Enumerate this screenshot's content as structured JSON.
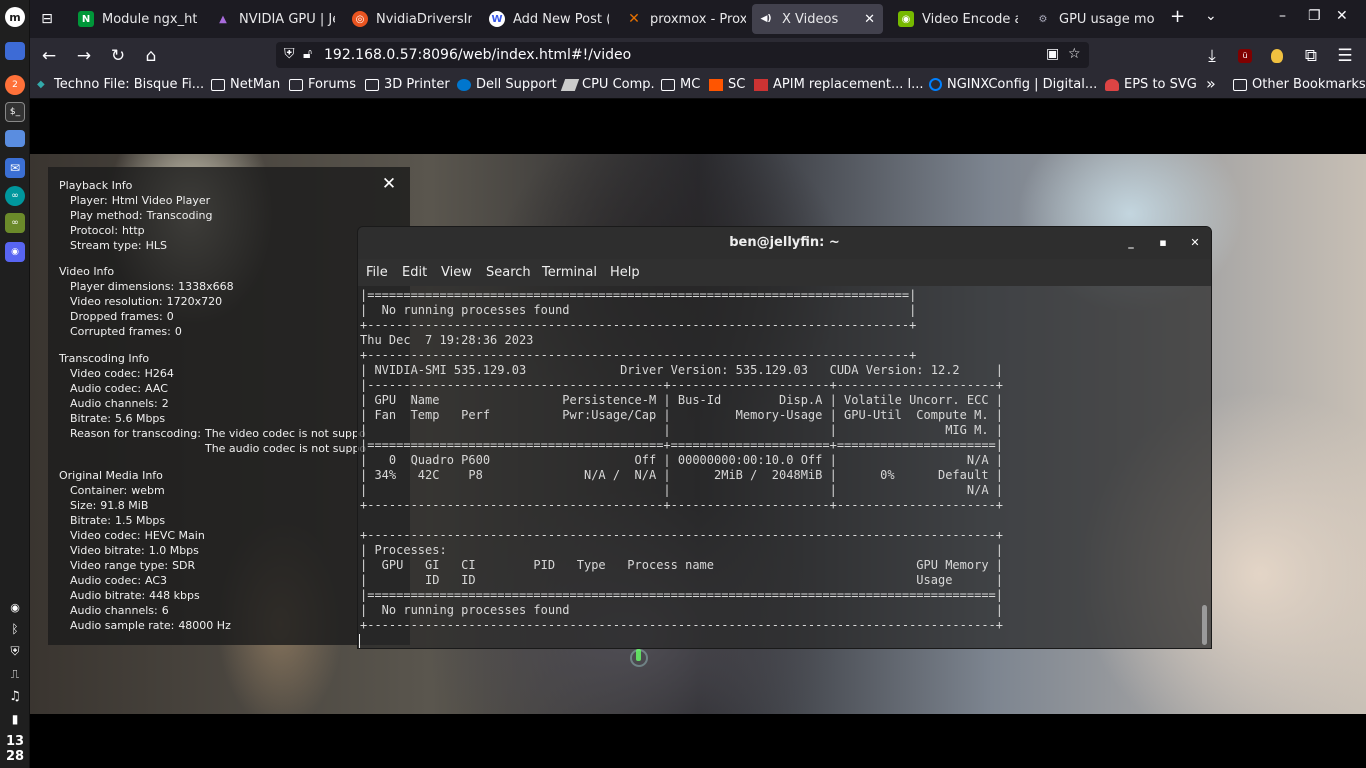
{
  "browser": {
    "tabs": [
      {
        "label": "Module ngx_ht",
        "icon": "nginx-icon",
        "color": "#009639"
      },
      {
        "label": "NVIDIA GPU | Je",
        "icon": "jellyfin-icon",
        "color": "#7a4bc9"
      },
      {
        "label": "NvidiaDriversIn",
        "icon": "ubuntu-icon",
        "color": "#e95420"
      },
      {
        "label": "Add New Post (",
        "icon": "wordpress-icon",
        "color": "#3858e9"
      },
      {
        "label": "proxmox - Prox",
        "icon": "proxmox-icon",
        "color": "#e57000"
      },
      {
        "label": "X Videos",
        "icon": "video-icon",
        "color": "#fbfbfe",
        "active": true
      },
      {
        "label": "Video Encode a",
        "icon": "nvidia-icon",
        "color": "#76b900"
      },
      {
        "label": "GPU usage mon",
        "icon": "github-icon",
        "color": "#6e7681"
      }
    ],
    "url": "192.168.0.57:8096/web/index.html#!/video",
    "bookmarks": [
      {
        "label": "Techno File: Bisque Fi...",
        "icon": "leaf-icon"
      },
      {
        "label": "NetMan",
        "icon": "folder-icon"
      },
      {
        "label": "Forums",
        "icon": "folder-icon"
      },
      {
        "label": "3D Printer",
        "icon": "folder-icon"
      },
      {
        "label": "Dell Support",
        "icon": "dell-icon"
      },
      {
        "label": "CPU Comp.",
        "icon": "cpu-icon"
      },
      {
        "label": "MC",
        "icon": "folder-icon"
      },
      {
        "label": "SC",
        "icon": "soundcloud-icon"
      },
      {
        "label": "APIM replacement... l...",
        "icon": "apim-icon"
      },
      {
        "label": "NGINXConfig | Digital...",
        "icon": "digitalocean-icon"
      },
      {
        "label": "EPS to SVG",
        "icon": "convert-icon"
      }
    ],
    "other_bookmarks": "Other Bookmarks",
    "more_bookmarks": "»"
  },
  "system": {
    "clock_hour": "13",
    "clock_min": "28",
    "badge": "2"
  },
  "playback_info": {
    "sections": [
      {
        "title": "Playback Info",
        "rows": [
          {
            "label": "Player:",
            "value": "Html Video Player"
          },
          {
            "label": "Play method:",
            "value": "Transcoding"
          },
          {
            "label": "Protocol:",
            "value": "http"
          },
          {
            "label": "Stream type:",
            "value": "HLS"
          }
        ]
      },
      {
        "title": "Video Info",
        "rows": [
          {
            "label": "Player dimensions:",
            "value": "1338x668"
          },
          {
            "label": "Video resolution:",
            "value": "1720x720"
          },
          {
            "label": "Dropped frames:",
            "value": "0"
          },
          {
            "label": "Corrupted frames:",
            "value": "0"
          }
        ]
      },
      {
        "title": "Transcoding Info",
        "rows": [
          {
            "label": "Video codec:",
            "value": "H264"
          },
          {
            "label": "Audio codec:",
            "value": "AAC"
          },
          {
            "label": "Audio channels:",
            "value": "2"
          },
          {
            "label": "Bitrate:",
            "value": "5.6 Mbps"
          }
        ],
        "reason_label": "Reason for transcoding:",
        "reasons": [
          "The video codec is not suppo",
          "The audio codec is not suppo"
        ]
      },
      {
        "title": "Original Media Info",
        "rows": [
          {
            "label": "Container:",
            "value": "webm"
          },
          {
            "label": "Size:",
            "value": "91.8 MiB"
          },
          {
            "label": "Bitrate:",
            "value": "1.5 Mbps"
          },
          {
            "label": "Video codec:",
            "value": "HEVC Main"
          },
          {
            "label": "Video bitrate:",
            "value": "1.0 Mbps"
          },
          {
            "label": "Video range type:",
            "value": "SDR"
          },
          {
            "label": "Audio codec:",
            "value": "AC3"
          },
          {
            "label": "Audio bitrate:",
            "value": "448 kbps"
          },
          {
            "label": "Audio channels:",
            "value": "6"
          },
          {
            "label": "Audio sample rate:",
            "value": "48000 Hz"
          }
        ]
      }
    ],
    "close": "✕"
  },
  "terminal": {
    "title": "ben@jellyfin: ~",
    "menu": [
      "File",
      "Edit",
      "View",
      "Search",
      "Terminal",
      "Help"
    ],
    "lines": [
      "|===========================================================================|",
      "|  No running processes found                                               |",
      "+---------------------------------------------------------------------------+",
      "Thu Dec  7 19:28:36 2023",
      "+---------------------------------------------------------------------------+",
      "| NVIDIA-SMI 535.129.03             Driver Version: 535.129.03   CUDA Version: 12.2     |",
      "|-----------------------------------------+----------------------+----------------------+",
      "| GPU  Name                 Persistence-M | Bus-Id        Disp.A | Volatile Uncorr. ECC |",
      "| Fan  Temp   Perf          Pwr:Usage/Cap |         Memory-Usage | GPU-Util  Compute M. |",
      "|                                         |                      |               MIG M. |",
      "|=========================================+======================+======================|",
      "|   0  Quadro P600                    Off | 00000000:00:10.0 Off |                  N/A |",
      "| 34%   42C    P8              N/A /  N/A |      2MiB /  2048MiB |      0%      Default |",
      "|                                         |                      |                  N/A |",
      "+-----------------------------------------+----------------------+----------------------+",
      "",
      "+---------------------------------------------------------------------------------------+",
      "| Processes:                                                                            |",
      "|  GPU   GI   CI        PID   Type   Process name                            GPU Memory |",
      "|        ID   ID                                                             Usage      |",
      "|=======================================================================================|",
      "|  No running processes found                                                           |",
      "+---------------------------------------------------------------------------------------+"
    ]
  }
}
